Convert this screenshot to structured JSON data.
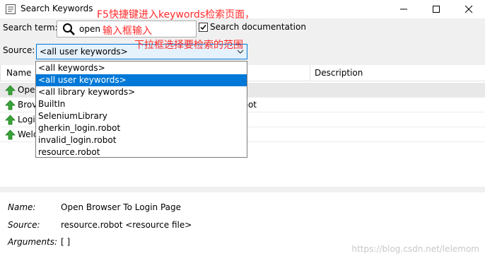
{
  "window": {
    "title": "Search Keywords"
  },
  "search": {
    "term_label": "Search term:",
    "value": "open",
    "checkbox_checked": true,
    "doc_label": "Search documentation"
  },
  "source": {
    "label": "Source:",
    "selected": "<all user keywords>",
    "options": [
      "<all keywords>",
      "<all user keywords>",
      "<all library keywords>",
      "BuiltIn",
      "SeleniumLibrary",
      "gherkin_login.robot",
      "invalid_login.robot",
      "resource.robot"
    ],
    "highlighted_index": 1
  },
  "grid": {
    "headers": [
      "Name",
      "Description"
    ],
    "rows": [
      {
        "icon": "keyword-arrow-icon",
        "name": "Ope",
        "source": ""
      },
      {
        "icon": "keyword-arrow-icon",
        "name": "Brov",
        "source": "obot"
      },
      {
        "icon": "keyword-arrow-icon",
        "name": "Logi",
        "source": ""
      },
      {
        "icon": "keyword-arrow-icon",
        "name": "Welc",
        "source": ""
      }
    ]
  },
  "details": {
    "name_label": "Name:",
    "name_value": "Open Browser To Login Page",
    "source_label": "Source:",
    "source_value": "resource.robot <resource file>",
    "arguments_label": "Arguments:",
    "arguments_value": "[ ]"
  },
  "annotations": {
    "note1": "F5快捷键进入keywords检索页面，",
    "note2": "输入框输入",
    "note3": "下拉框选择要检索的范围",
    "watermark": "https://blog.csdn.net/lelemom"
  },
  "colors": {
    "accent": "#0078d7",
    "annotation": "#ff2a2a",
    "icon_green": "#3aa43a"
  }
}
